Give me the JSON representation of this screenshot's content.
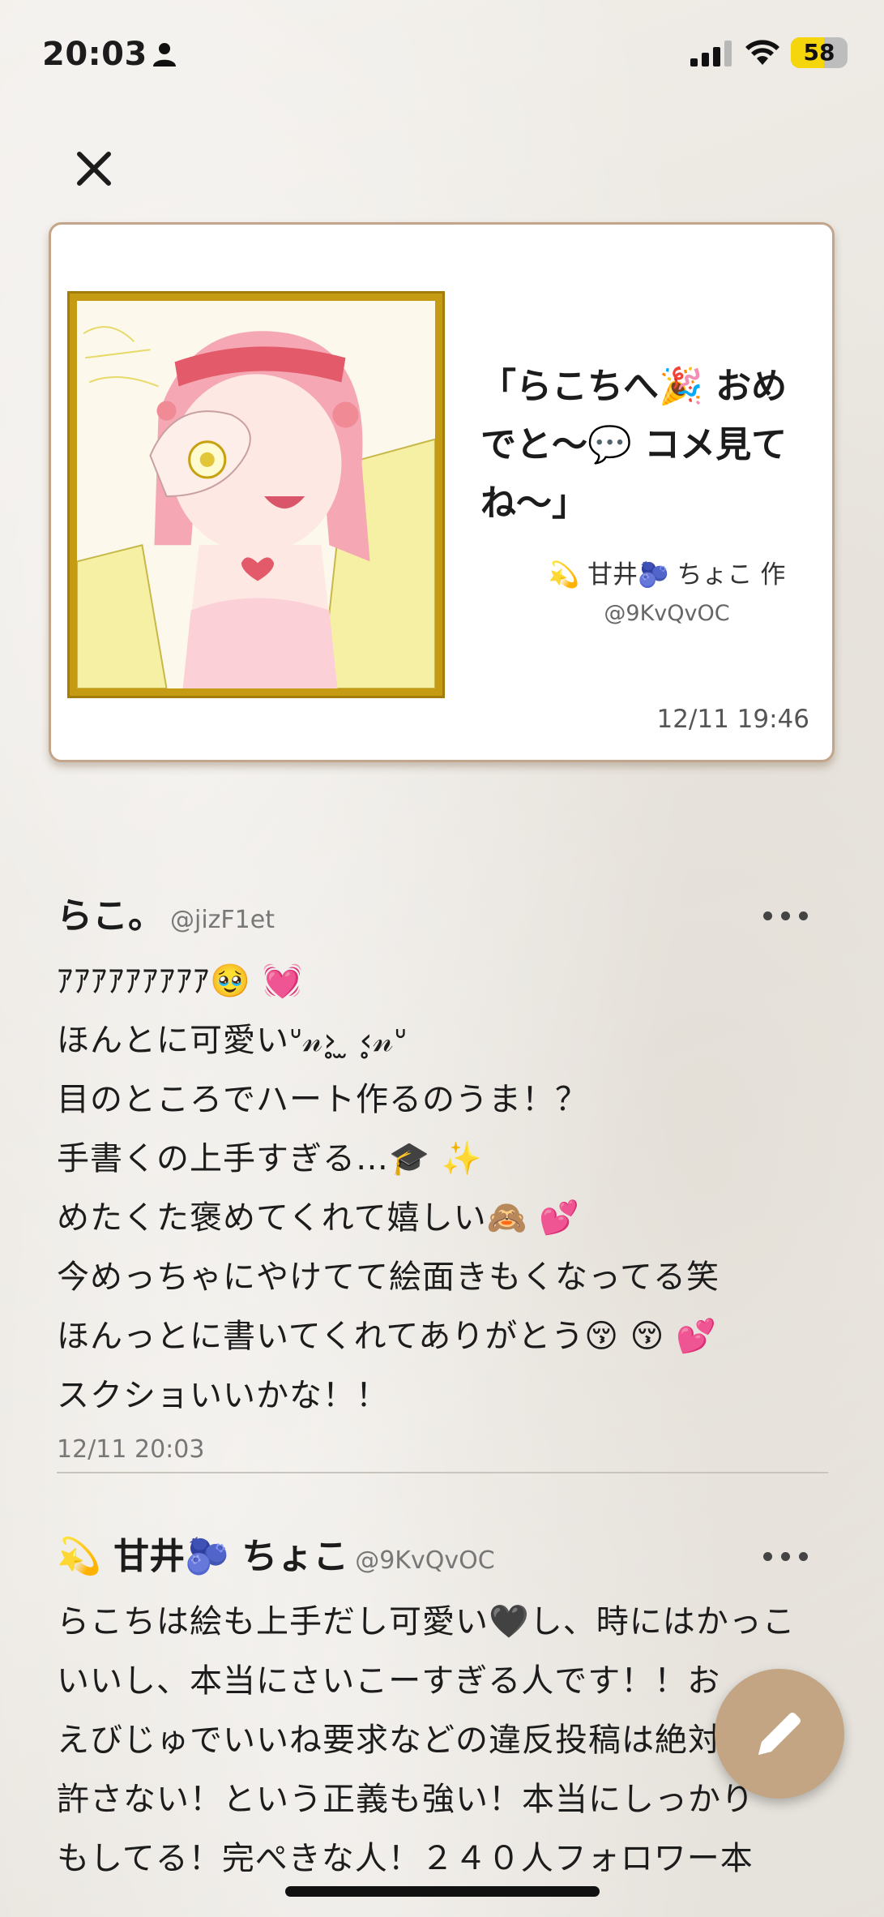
{
  "status_bar": {
    "time": "20:03",
    "battery": "58",
    "battery_level": 0.58
  },
  "card": {
    "title": "「らこちへ🎉 おめでと〜💬 コメ見てね〜」",
    "author": "💫 甘井🫐 ちょこ 作",
    "handle": "@9KvQvOC",
    "date": "12/11 19:46",
    "artwork_icon": "drawing-artwork"
  },
  "comments": [
    {
      "name": "らこ。",
      "handle": "@jizF1et",
      "body": "ｱｱｱｱｱｱｱｱｱ🥹 💓\nほんとに可愛いᐡ𝓃›̥̥ ̫ ‹̥̥𝓃ᐡ\n目のところでハート作るのうま！？\n手書くの上手すぎる…🎓 ✨\nめたくた褒めてくれて嬉しい🙈 💕\n今めっちゃにやけてて絵面きもくなってる笑\nほんっとに書いてくれてありがとう😚 😚 💕\nスクショいいかな！！",
      "date": "12/11 20:03"
    },
    {
      "name": "💫 甘井🫐 ちょこ",
      "handle": "@9KvQvOC",
      "body": "らこちは絵も上手だし可愛い🖤し、時にはかっこいいし、本当にさいこーすぎる人です！！お\nえびじゅでいいね要求などの違反投稿は絶対\n許さない！という正義も強い！本当にしっかり\nもしてる！完ぺきな人！２４０人フォロワー本"
    }
  ],
  "colors": {
    "accent": "#c3a584",
    "frame_gold": "#c59b14",
    "card_border": "#c2a58a"
  }
}
